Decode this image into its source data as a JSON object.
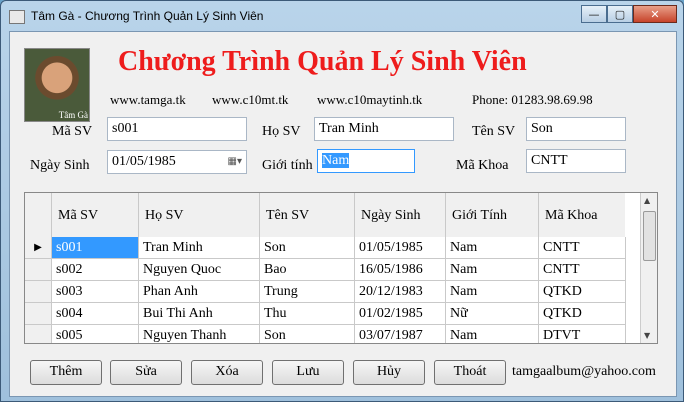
{
  "window": {
    "title": "Tâm Gà - Chương Trình Quản Lý Sinh Viên",
    "caption_min": "—",
    "caption_max": "▢",
    "caption_close": "✕"
  },
  "header": {
    "title": "Chương Trình Quản Lý Sinh Viên",
    "avatar_caption": "Tâm Gà",
    "site1": "www.tamga.tk",
    "site2": "www.c10mt.tk",
    "site3": "www.c10maytinh.tk",
    "phone": "Phone: 01283.98.69.98"
  },
  "form": {
    "ma_sv_label": "Mã SV",
    "ma_sv_value": "s001",
    "ho_sv_label": "Họ SV",
    "ho_sv_value": "Tran Minh",
    "ten_sv_label": "Tên SV",
    "ten_sv_value": "Son",
    "ngay_sinh_label": "Ngày Sinh",
    "ngay_sinh_value": "01/05/1985",
    "gioi_tinh_label": "Giới tính",
    "gioi_tinh_value": "Nam",
    "ma_khoa_label": "Mã Khoa",
    "ma_khoa_value": "CNTT"
  },
  "grid": {
    "columns": [
      "Mã SV",
      "Họ SV",
      "Tên SV",
      "Ngày Sinh",
      "Giới Tính",
      "Mã Khoa"
    ],
    "rows": [
      [
        "s001",
        "Tran Minh",
        "Son",
        "01/05/1985",
        "Nam",
        "CNTT"
      ],
      [
        "s002",
        "Nguyen Quoc",
        "Bao",
        "16/05/1986",
        "Nam",
        "CNTT"
      ],
      [
        "s003",
        "Phan Anh",
        "Trung",
        "20/12/1983",
        "Nam",
        "QTKD"
      ],
      [
        "s004",
        "Bui Thi Anh",
        "Thu",
        "01/02/1985",
        "Nữ",
        "QTKD"
      ],
      [
        "s005",
        "Nguyen Thanh",
        "Son",
        "03/07/1987",
        "Nam",
        "DTVT"
      ]
    ]
  },
  "buttons": {
    "them": "Thêm",
    "sua": "Sửa",
    "xoa": "Xóa",
    "luu": "Lưu",
    "huy": "Hủy",
    "thoat": "Thoát"
  },
  "footer": {
    "email": "tamgaalbum@yahoo.com"
  },
  "icons": {
    "row_pointer": "▶",
    "date_dropdown": "calendar-dropdown-icon"
  }
}
